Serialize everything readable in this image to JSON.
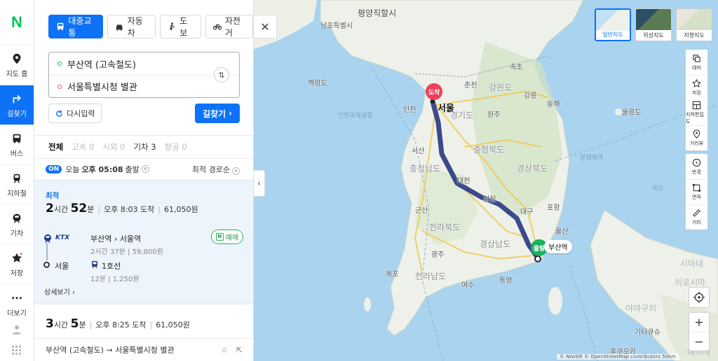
{
  "brand": {
    "logo": "N"
  },
  "rail": {
    "items": [
      {
        "label": "지도 홈",
        "icon": "pin-icon",
        "active": false
      },
      {
        "label": "길찾기",
        "icon": "directions-icon",
        "active": true
      },
      {
        "label": "버스",
        "icon": "bus-icon",
        "active": false
      },
      {
        "label": "지하철",
        "icon": "subway-icon",
        "active": false
      },
      {
        "label": "기차",
        "icon": "train-icon",
        "active": false
      },
      {
        "label": "저장",
        "icon": "star-icon",
        "active": false
      },
      {
        "label": "더보기",
        "icon": "more-icon",
        "active": false
      }
    ]
  },
  "modes": [
    {
      "label": "대중교통",
      "icon": "bus-icon",
      "active": true
    },
    {
      "label": "자동차",
      "icon": "car-icon",
      "active": false
    },
    {
      "label": "도보",
      "icon": "walk-icon",
      "active": false
    },
    {
      "label": "자전거",
      "icon": "bike-icon",
      "active": false
    }
  ],
  "route": {
    "from": "부산역 (고속철도)",
    "to": "서울특별시청 별관"
  },
  "buttons": {
    "reset": "다시입력",
    "search": "길찾기"
  },
  "tabs": [
    {
      "label": "전체",
      "state": "on"
    },
    {
      "label": "고속 0",
      "state": "off"
    },
    {
      "label": "시외 0",
      "state": "off"
    },
    {
      "label": "기차 3",
      "state": "dark"
    },
    {
      "label": "항공 0",
      "state": "off"
    }
  ],
  "options": {
    "on": "ON",
    "day": "오늘",
    "time": "오후 05:08",
    "depart": "출발",
    "sort": "최적 경로순"
  },
  "results": [
    {
      "tag": "최적",
      "hours": "2",
      "hours_unit": "시간",
      "mins": "52",
      "mins_unit": "분",
      "arrive": "오후 8:03 도착",
      "fare": "61,050원",
      "legs": {
        "ktx_logo": "KTX",
        "train_route": "부산역 › 서울역",
        "train_info": "2시간 37분 | 59,800원",
        "book": "예매",
        "transfer_station": "서울",
        "subway_line": "1호선",
        "subway_info": "12분 | 1,250원"
      },
      "detail": "상세보기 ›"
    },
    {
      "hours": "3",
      "hours_unit": "시간",
      "mins": "5",
      "mins_unit": "분",
      "arrive": "오후 8:25 도착",
      "fare": "61,050원"
    }
  ],
  "footer": {
    "route": "부산역 (고속철도) → 서울특별시청 별관"
  },
  "map": {
    "types": [
      "일반지도",
      "위성지도",
      "지형지도"
    ],
    "tools": [
      "테마",
      "저장",
      "지적편집도",
      "거리뷰"
    ],
    "tools2": [
      "반경",
      "면적",
      "거리"
    ],
    "pins": {
      "arrive": "도착",
      "depart": "출발",
      "depart_label": "부산역"
    },
    "labels": {
      "pyongyang": "평양직할시",
      "nampo": "남포특별시",
      "sokcho": "속초",
      "baengnyeong": "백령도",
      "chuncheon": "춘천",
      "gangwon": "강원도",
      "gangneung": "강릉",
      "donghae": "동해",
      "incheon": "인천",
      "seoul": "서울",
      "gyeonggi": "경기도",
      "wonju": "원주",
      "ulleung": "울릉도",
      "incheonairport": "인천국제공항",
      "seosan": "서산",
      "chungbuk": "충청북도",
      "chungnam": "충청남도",
      "daejeon": "대전",
      "gyeongbuk": "경상북도",
      "dokdo": "독도",
      "gimcheon": "김천",
      "pohang": "포항",
      "daegu": "대구",
      "gunsan": "군산",
      "jeonbuk": "전라북도",
      "ulsan": "울산",
      "gyeongnam": "경상남도",
      "gwangju": "광주",
      "jeonnam": "전라남도",
      "mokpo": "목포",
      "yeosu": "여수",
      "tongyeong": "통영",
      "shimane": "시마네",
      "hiroshima": "히로시마",
      "yamaguchi": "야마구치",
      "kitakyushu": "기타큐슈",
      "fukuoka": "후쿠오카",
      "ehime": "에히메",
      "sea": "분쟁해역"
    },
    "attribution": "© NAVER  © OpenStreetMap contributors   50km"
  }
}
